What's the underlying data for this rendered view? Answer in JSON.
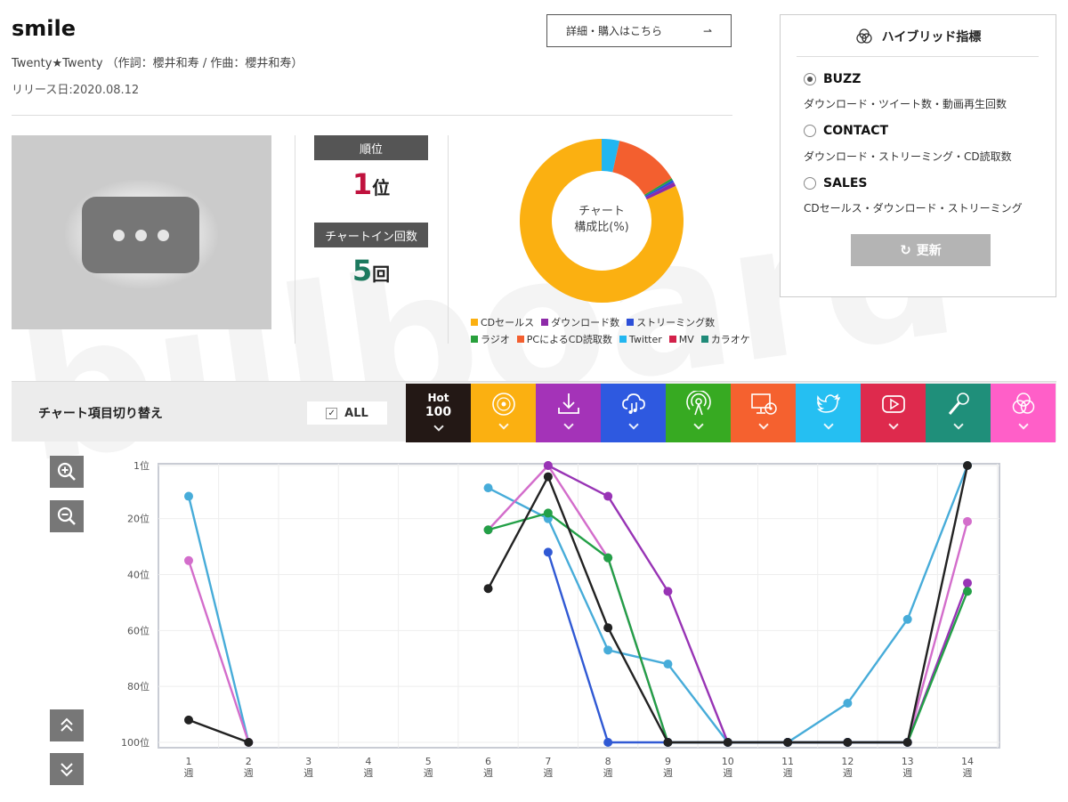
{
  "song": {
    "title": "smile",
    "artist_line": "Twenty★Twenty  （作詞：櫻井和寿 / 作曲：櫻井和寿）",
    "release": "リリース日:2020.08.12",
    "detail_button": "詳細・購入はこちら"
  },
  "stats": {
    "rank_label": "順位",
    "rank_value": "1",
    "rank_unit": "位",
    "chartin_label": "チャートイン回数",
    "chartin_value": "5",
    "chartin_unit": "回"
  },
  "donut": {
    "label_line1": "チャート",
    "label_line2": "構成比(%)",
    "slices": [
      {
        "name": "CDセールス",
        "value": 82,
        "color": "#fbb011"
      },
      {
        "name": "ダウンロード数",
        "value": 0.8,
        "color": "#8d2aa8"
      },
      {
        "name": "ストリーミング数",
        "value": 0.5,
        "color": "#2c4fd8"
      },
      {
        "name": "ラジオ",
        "value": 0.4,
        "color": "#29a03c"
      },
      {
        "name": "PCによるCD読取数",
        "value": 12.8,
        "color": "#f35f2f"
      },
      {
        "name": "Twitter",
        "value": 3.5,
        "color": "#22b6f0"
      },
      {
        "name": "MV",
        "value": 0,
        "color": "#d3214a"
      },
      {
        "name": "カラオケ",
        "value": 0,
        "color": "#1f8a78"
      }
    ],
    "legend_row1": [
      "CDセールス",
      "ダウンロード数",
      "ストリーミング数"
    ],
    "legend_row2": [
      "ラジオ",
      "PCによるCD読取数",
      "Twitter",
      "MV",
      "カラオケ"
    ]
  },
  "hybrid": {
    "title": "ハイブリッド指標",
    "options": [
      {
        "label": "BUZZ",
        "desc": "ダウンロード・ツイート数・動画再生回数",
        "selected": true
      },
      {
        "label": "CONTACT",
        "desc": "ダウンロード・ストリーミング・CD読取数",
        "selected": false
      },
      {
        "label": "SALES",
        "desc": "CDセールス・ダウンロード・ストリーミング",
        "selected": false
      }
    ],
    "refresh_label": "更新"
  },
  "switcher": {
    "title": "チャート項目切り替え",
    "all_label": "ALL",
    "hot_label_1": "Hot",
    "hot_label_2": "100",
    "tabs": [
      {
        "icon": "cd-icon",
        "color": "#fbb011"
      },
      {
        "icon": "download-icon",
        "color": "#a433b8"
      },
      {
        "icon": "cloud-music-icon",
        "color": "#2e59e0"
      },
      {
        "icon": "radio-broadcast-icon",
        "color": "#37aa22"
      },
      {
        "icon": "pc-cd-icon",
        "color": "#f5612f"
      },
      {
        "icon": "twitter-icon",
        "color": "#25bff2"
      },
      {
        "icon": "youtube-icon",
        "color": "#de2a4d"
      },
      {
        "icon": "microphone-icon",
        "color": "#1f8f7a"
      },
      {
        "icon": "hybrid-circles-icon",
        "color": "#ff5fc8"
      }
    ]
  },
  "chart_data": {
    "type": "line",
    "x": [
      "1\n週",
      "2\n週",
      "3\n週",
      "4\n週",
      "5\n週",
      "6\n週",
      "7\n週",
      "8\n週",
      "9\n週",
      "10\n週",
      "11\n週",
      "12\n週",
      "13\n週",
      "14\n週"
    ],
    "y_ticks": [
      "1位",
      "20位",
      "40位",
      "60位",
      "80位",
      "100位"
    ],
    "ylim": [
      1,
      100
    ],
    "y_inverted": true,
    "grid": true,
    "series": [
      {
        "color": "#47acd9",
        "values": [
          12,
          100,
          null,
          null,
          null,
          9,
          20,
          67,
          72,
          100,
          100,
          86,
          56,
          1
        ]
      },
      {
        "color": "#d36dcb",
        "values": [
          35,
          100,
          null,
          null,
          null,
          24,
          1,
          34,
          100,
          100,
          100,
          100,
          100,
          21
        ]
      },
      {
        "color": "#9834b5",
        "values": [
          null,
          null,
          null,
          null,
          null,
          null,
          1,
          12,
          46,
          100,
          100,
          100,
          100,
          43
        ]
      },
      {
        "color": "#23a047",
        "values": [
          null,
          null,
          null,
          null,
          null,
          24,
          18,
          34,
          100,
          100,
          100,
          100,
          100,
          46
        ]
      },
      {
        "color": "#3059d4",
        "values": [
          null,
          null,
          null,
          null,
          null,
          null,
          32,
          100,
          100,
          100,
          100,
          100,
          100,
          null
        ]
      },
      {
        "color": "#222222",
        "values": [
          92,
          100,
          null,
          null,
          null,
          45,
          5,
          59,
          100,
          100,
          100,
          100,
          100,
          1
        ]
      }
    ]
  }
}
